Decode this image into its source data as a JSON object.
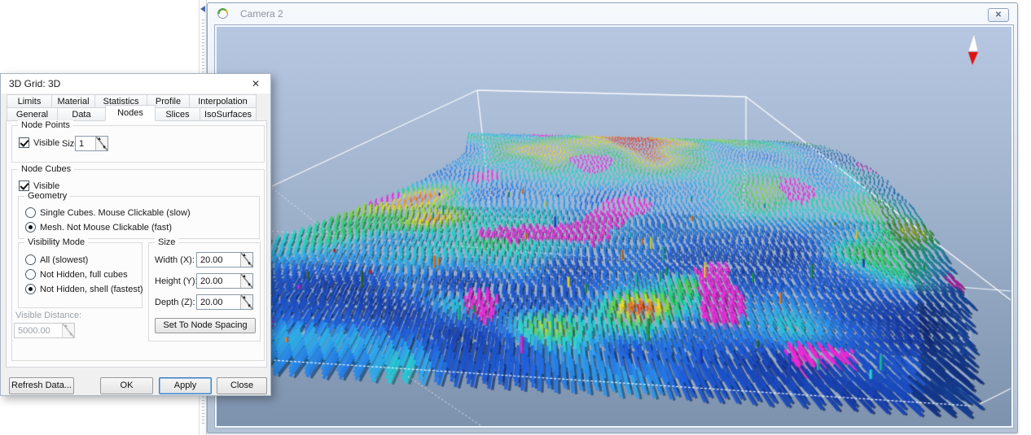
{
  "window": {
    "title": "Camera 2",
    "close_glyph": "✕"
  },
  "dialog": {
    "title": "3D Grid: 3D",
    "close_glyph": "✕",
    "tabs_row1": [
      {
        "label": "Limits"
      },
      {
        "label": "Material"
      },
      {
        "label": "Statistics"
      },
      {
        "label": "Profile"
      },
      {
        "label": "Interpolation"
      }
    ],
    "tabs_row2": [
      {
        "label": "General"
      },
      {
        "label": "Data"
      },
      {
        "label": "Nodes",
        "selected": true
      },
      {
        "label": "Slices"
      },
      {
        "label": "IsoSurfaces"
      }
    ],
    "node_points": {
      "legend": "Node Points",
      "visible_label": "Visible",
      "visible_checked": true,
      "size_label": "Size:",
      "size_value": "1"
    },
    "node_cubes": {
      "legend": "Node Cubes",
      "visible_label": "Visible",
      "visible_checked": true,
      "geometry": {
        "legend": "Geometry",
        "options": [
          {
            "label": "Single Cubes. Mouse Clickable (slow)",
            "selected": false
          },
          {
            "label": "Mesh. Not Mouse Clickable (fast)",
            "selected": true
          }
        ]
      },
      "visibility_mode": {
        "legend": "Visibility Mode",
        "options": [
          {
            "label": "All (slowest)",
            "selected": false
          },
          {
            "label": "Not Hidden, full cubes",
            "selected": false
          },
          {
            "label": "Not Hidden, shell (fastest)",
            "selected": true
          }
        ]
      },
      "size": {
        "legend": "Size",
        "fields": [
          {
            "label": "Width (X):",
            "value": "20.00"
          },
          {
            "label": "Height (Y):",
            "value": "20.00"
          },
          {
            "label": "Depth (Z):",
            "value": "20.00"
          }
        ],
        "button": "Set To Node Spacing"
      },
      "visible_distance": {
        "label": "Visible Distance:",
        "value": "5000.00",
        "disabled": true
      }
    },
    "buttons": {
      "refresh": "Refresh Data...",
      "ok": "OK",
      "apply": "Apply",
      "close": "Close"
    }
  },
  "scene": {
    "bg_top": "#b7c7e1",
    "bg_mid": "#9fb2cc",
    "bg_bottom": "#7d92ad",
    "haze": "rgba(160,184,214,0.5)",
    "wire_color": "#ffffff",
    "compass_north": "#ffffff",
    "compass_south": "#dd1111",
    "magenta": "#e829d8",
    "seed": 7,
    "colormap": [
      [
        0.0,
        "#16359f"
      ],
      [
        0.3,
        "#1f62e0"
      ],
      [
        0.45,
        "#2fa3ef"
      ],
      [
        0.56,
        "#22d6cf"
      ],
      [
        0.66,
        "#2fd05f"
      ],
      [
        0.76,
        "#9fe02f"
      ],
      [
        0.83,
        "#efe01f"
      ],
      [
        0.9,
        "#ef8f1f"
      ],
      [
        1.0,
        "#df1f1f"
      ]
    ],
    "bumps": [
      [
        0.42,
        0.07,
        0.1,
        0.38
      ],
      [
        0.52,
        0.22,
        0.09,
        0.3
      ],
      [
        0.07,
        0.45,
        0.07,
        0.42
      ],
      [
        0.16,
        0.52,
        0.05,
        0.35
      ],
      [
        0.3,
        0.8,
        0.05,
        0.45
      ],
      [
        0.42,
        0.86,
        0.05,
        0.5
      ],
      [
        0.55,
        0.78,
        0.05,
        0.55
      ],
      [
        0.62,
        0.7,
        0.04,
        0.4
      ],
      [
        0.97,
        0.5,
        0.05,
        0.3
      ]
    ],
    "pillar_colors": [
      "#1f9e4a",
      "#20b2aa",
      "#2fd8e0",
      "#2244cc",
      "#e8e020",
      "#e029d0",
      "#2e6b3a",
      "#f08020",
      "#d02020"
    ]
  }
}
